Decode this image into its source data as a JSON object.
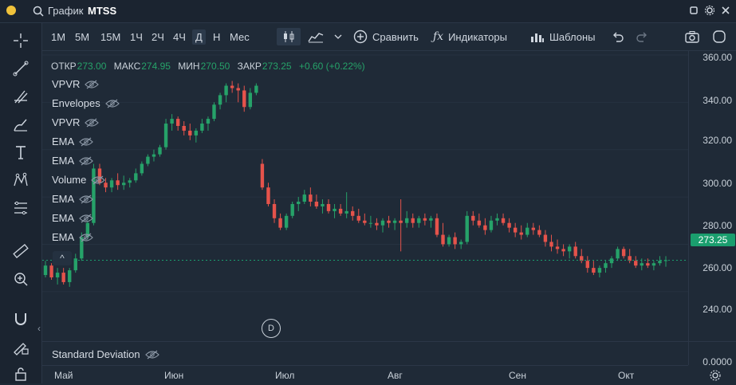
{
  "window": {
    "title_prefix": "График",
    "symbol": "MTSS"
  },
  "timeframes": [
    "1М",
    "5М",
    "15М",
    "1Ч",
    "2Ч",
    "4Ч",
    "Д",
    "Н",
    "Мес"
  ],
  "active_timeframe": "Д",
  "toolbar": {
    "compare_label": "Сравнить",
    "indicators_label": "Индикаторы",
    "templates_label": "Шаблоны"
  },
  "ohlc": {
    "open_label": "ОТКР",
    "open": "273.00",
    "high_label": "МАКС",
    "high": "274.95",
    "low_label": "МИН",
    "low": "270.50",
    "close_label": "ЗАКР",
    "close": "273.25",
    "change": "+0.60 (+0.22%)"
  },
  "indicators": [
    "VPVR",
    "Envelopes",
    "VPVR",
    "EMA",
    "EMA",
    "Volume",
    "EMA",
    "EMA",
    "EMA"
  ],
  "subpane_indicator": "Standard Deviation",
  "price_axis": [
    "360.00",
    "340.00",
    "320.00",
    "300.00",
    "280.00",
    "260.00",
    "240.00",
    "0.0000"
  ],
  "current_price": "273.25",
  "time_axis": [
    "Май",
    "Июн",
    "Июл",
    "Авг",
    "Сен",
    "Окт"
  ],
  "marker_label": "D",
  "colors": {
    "up": "#26a269",
    "down": "#e5534b",
    "background": "#1f2a37",
    "accent": "#1a9e6e"
  },
  "chart_data": {
    "type": "candlestick",
    "ylim": [
      234,
      362
    ],
    "candles": [
      [
        267,
        273,
        266,
        271
      ],
      [
        271,
        272,
        265,
        266
      ],
      [
        266,
        270,
        263,
        268
      ],
      [
        268,
        270,
        263,
        264
      ],
      [
        264,
        270,
        262,
        269
      ],
      [
        269,
        276,
        268,
        274
      ],
      [
        274,
        285,
        273,
        283
      ],
      [
        283,
        290,
        282,
        289
      ],
      [
        289,
        314,
        288,
        312
      ],
      [
        312,
        314,
        305,
        306
      ],
      [
        306,
        308,
        302,
        304
      ],
      [
        304,
        308,
        302,
        307
      ],
      [
        307,
        310,
        303,
        305
      ],
      [
        305,
        309,
        303,
        306
      ],
      [
        306,
        308,
        304,
        307
      ],
      [
        307,
        312,
        306,
        310
      ],
      [
        310,
        315,
        309,
        314
      ],
      [
        314,
        318,
        313,
        317
      ],
      [
        317,
        320,
        315,
        318
      ],
      [
        318,
        322,
        317,
        321
      ],
      [
        321,
        333,
        320,
        331
      ],
      [
        331,
        335,
        328,
        333
      ],
      [
        333,
        334,
        328,
        330
      ],
      [
        330,
        332,
        326,
        328
      ],
      [
        328,
        331,
        324,
        326
      ],
      [
        326,
        329,
        323,
        328
      ],
      [
        328,
        333,
        327,
        331
      ],
      [
        331,
        334,
        328,
        333
      ],
      [
        333,
        340,
        332,
        339
      ],
      [
        339,
        344,
        337,
        343
      ],
      [
        343,
        348,
        340,
        347
      ],
      [
        347,
        349,
        344,
        346
      ],
      [
        346,
        348,
        340,
        345
      ],
      [
        345,
        347,
        336,
        338
      ],
      [
        338,
        346,
        337,
        344
      ],
      [
        344,
        348,
        343,
        347
      ],
      [
        314,
        316,
        303,
        304
      ],
      [
        304,
        306,
        296,
        297
      ],
      [
        297,
        299,
        289,
        291
      ],
      [
        291,
        293,
        286,
        287
      ],
      [
        287,
        293,
        286,
        292
      ],
      [
        292,
        298,
        291,
        297
      ],
      [
        297,
        300,
        294,
        298
      ],
      [
        298,
        303,
        297,
        301
      ],
      [
        301,
        304,
        296,
        298
      ],
      [
        298,
        301,
        295,
        296
      ],
      [
        296,
        299,
        293,
        297
      ],
      [
        297,
        299,
        293,
        294
      ],
      [
        294,
        297,
        291,
        295
      ],
      [
        295,
        297,
        292,
        293
      ],
      [
        293,
        302,
        291,
        294
      ],
      [
        294,
        296,
        290,
        292
      ],
      [
        292,
        295,
        289,
        290
      ],
      [
        290,
        293,
        288,
        289
      ],
      [
        289,
        292,
        287,
        289
      ],
      [
        289,
        291,
        286,
        288
      ],
      [
        288,
        291,
        285,
        290
      ],
      [
        290,
        292,
        287,
        289
      ],
      [
        289,
        291,
        286,
        290
      ],
      [
        290,
        299,
        277,
        289
      ],
      [
        289,
        294,
        287,
        291
      ],
      [
        291,
        293,
        287,
        289
      ],
      [
        289,
        292,
        287,
        291
      ],
      [
        291,
        293,
        288,
        290
      ],
      [
        290,
        292,
        287,
        291
      ],
      [
        291,
        293,
        283,
        284
      ],
      [
        284,
        289,
        279,
        280
      ],
      [
        280,
        284,
        279,
        283
      ],
      [
        283,
        285,
        278,
        280
      ],
      [
        280,
        282,
        278,
        281
      ],
      [
        281,
        294,
        280,
        292
      ],
      [
        292,
        294,
        288,
        290
      ],
      [
        290,
        293,
        287,
        288
      ],
      [
        288,
        291,
        284,
        286
      ],
      [
        286,
        292,
        285,
        290
      ],
      [
        290,
        293,
        288,
        291
      ],
      [
        291,
        293,
        288,
        289
      ],
      [
        289,
        291,
        285,
        287
      ],
      [
        287,
        289,
        283,
        285
      ],
      [
        285,
        288,
        282,
        284
      ],
      [
        284,
        289,
        283,
        287
      ],
      [
        287,
        289,
        284,
        286
      ],
      [
        286,
        288,
        283,
        284
      ],
      [
        284,
        286,
        279,
        281
      ],
      [
        281,
        284,
        277,
        279
      ],
      [
        279,
        282,
        276,
        278
      ],
      [
        278,
        280,
        275,
        277
      ],
      [
        277,
        280,
        274,
        279
      ],
      [
        279,
        281,
        274,
        275
      ],
      [
        275,
        278,
        272,
        273
      ],
      [
        273,
        275,
        268,
        270
      ],
      [
        270,
        273,
        267,
        268
      ],
      [
        268,
        271,
        266,
        270
      ],
      [
        270,
        273,
        268,
        272
      ],
      [
        272,
        275,
        270,
        274
      ],
      [
        274,
        279,
        273,
        278
      ],
      [
        278,
        279,
        274,
        275
      ],
      [
        275,
        278,
        272,
        273
      ],
      [
        273,
        275,
        270,
        271
      ],
      [
        271,
        274,
        269,
        272
      ],
      [
        272,
        274,
        270,
        271
      ],
      [
        271,
        273,
        269,
        272
      ],
      [
        272,
        275,
        271,
        273
      ],
      [
        273,
        274.95,
        270.5,
        273.25
      ]
    ]
  }
}
